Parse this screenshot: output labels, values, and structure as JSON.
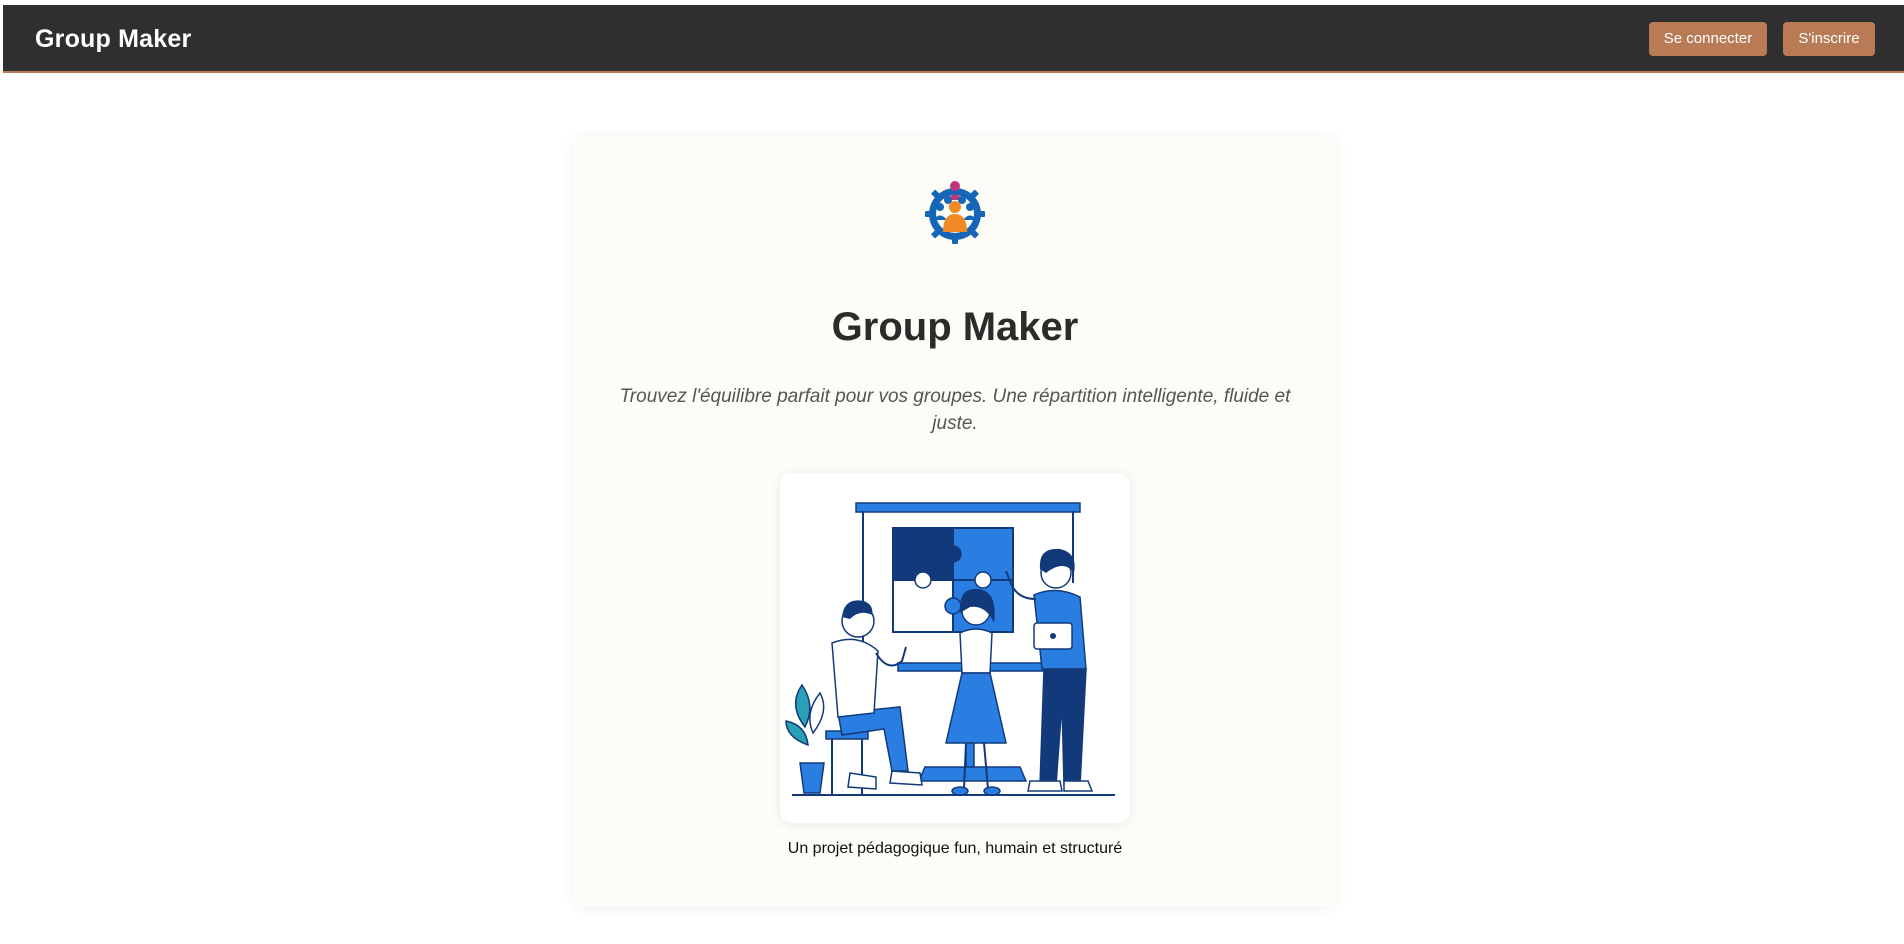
{
  "header": {
    "brand": "Group Maker",
    "login_label": "Se connecter",
    "signup_label": "S'inscrire"
  },
  "hero": {
    "title": "Group Maker",
    "tagline": "Trouvez l'équilibre parfait pour vos groupes. Une répartition intelligente, fluide et juste.",
    "caption": "Un projet pédagogique fun, humain et structuré",
    "logo_icon": "team-gear-icon",
    "illustration": "team-puzzle-illustration"
  },
  "colors": {
    "navbar": "#2f2f2f",
    "accent": "#b97a56",
    "card": "#fdfcf6",
    "blue": "#2a7de1",
    "navy": "#123a7a"
  }
}
